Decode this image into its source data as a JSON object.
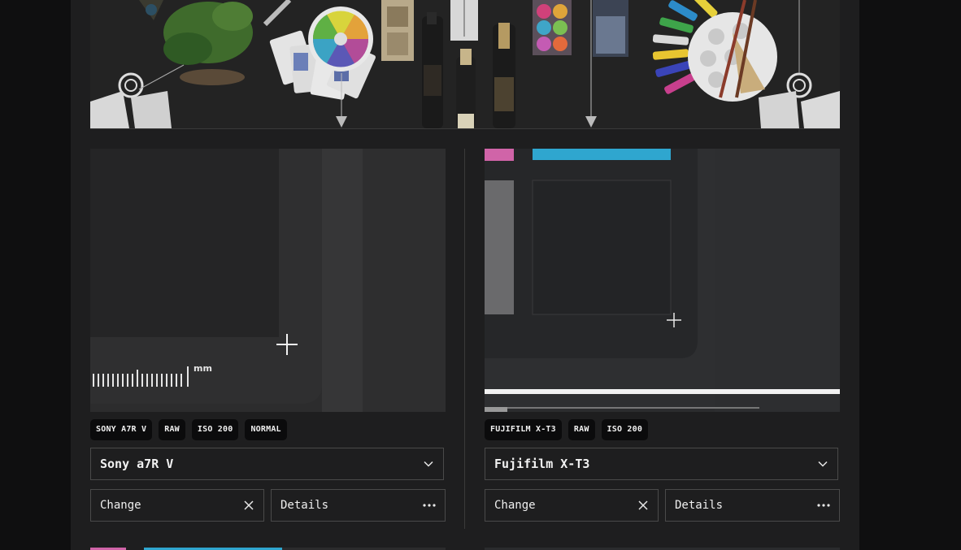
{
  "left": {
    "tags": [
      "SONY A7R V",
      "RAW",
      "ISO 200",
      "NORMAL"
    ],
    "camera": "Sony a7R V",
    "change_label": "Change",
    "details_label": "Details",
    "scale_unit": "mm"
  },
  "right": {
    "tags": [
      "FUJIFILM X-T3",
      "RAW",
      "ISO 200"
    ],
    "camera": "Fujifilm X-T3",
    "change_label": "Change",
    "details_label": "Details"
  },
  "colors": {
    "page_bg": "#0f0f10",
    "panel_bg": "#1e1e1f",
    "magenta_patch": "#d064a8",
    "cyan_patch": "#2fa6cf"
  },
  "icons": [
    "chevron-down-icon",
    "close-icon",
    "more-horizontal-icon",
    "crosshair-icon"
  ]
}
